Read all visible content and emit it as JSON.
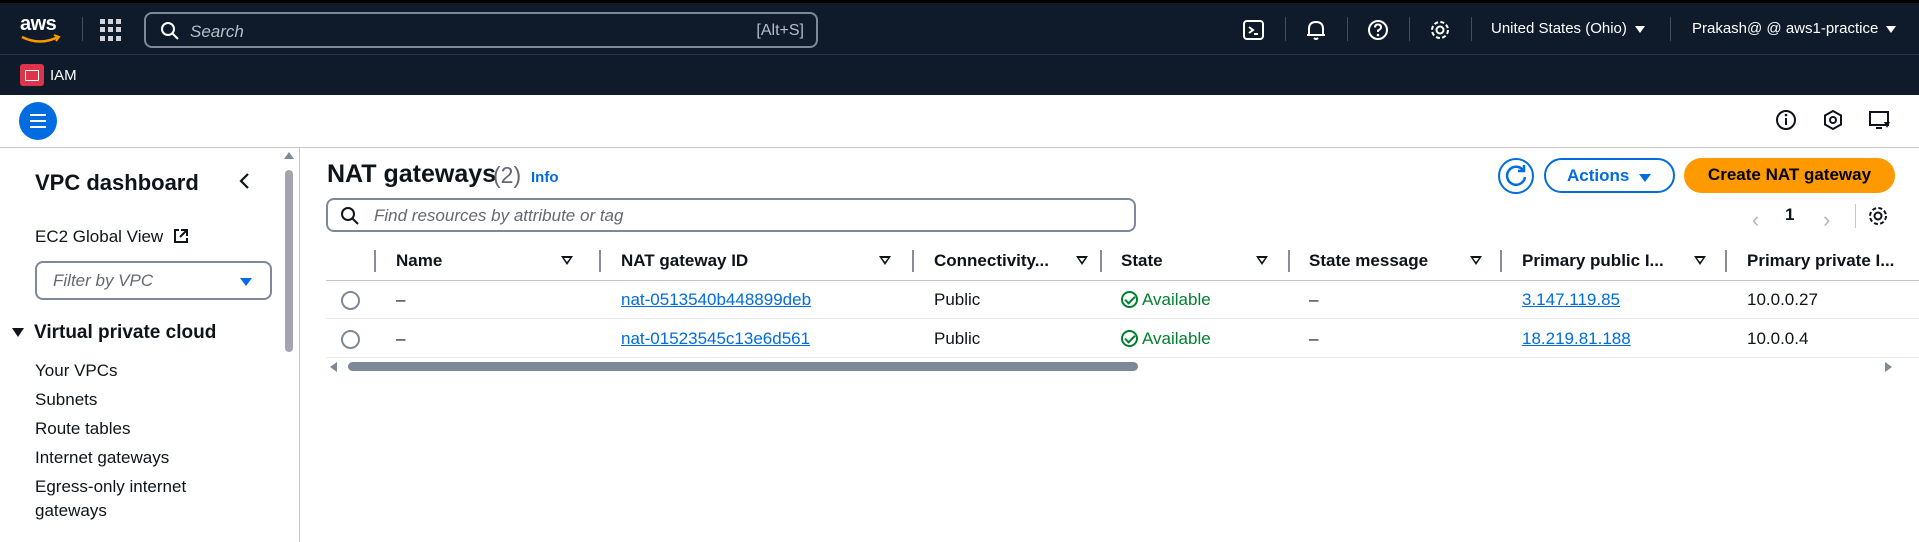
{
  "topnav": {
    "logo": "aws",
    "search_placeholder": "Search",
    "search_shortcut": "[Alt+S]",
    "region": "United States (Ohio)",
    "account": "Prakash@ @ aws1-practice",
    "icons": [
      "cloudshell-icon",
      "bell-icon",
      "help-icon",
      "gear-icon"
    ]
  },
  "service_bar": {
    "label": "IAM",
    "icon": "iam-icon"
  },
  "sidebar": {
    "title": "VPC dashboard",
    "global_view": "EC2 Global View",
    "filter_placeholder": "Filter by VPC",
    "section": "Virtual private cloud",
    "items": [
      "Your VPCs",
      "Subnets",
      "Route tables",
      "Internet gateways",
      "Egress-only internet gateways"
    ]
  },
  "main": {
    "title": "NAT gateways",
    "count": "(2)",
    "info": "Info",
    "actions": "Actions",
    "create": "Create NAT gateway",
    "search_placeholder": "Find resources by attribute or tag",
    "page": "1"
  },
  "table": {
    "columns": [
      "Name",
      "NAT gateway ID",
      "Connectivity...",
      "State",
      "State message",
      "Primary public I...",
      "Primary private I..."
    ],
    "rows": [
      {
        "name": "–",
        "id": "nat-0513540b448899deb",
        "connectivity": "Public",
        "state": "Available",
        "message": "–",
        "public_ip": "3.147.119.85",
        "private_ip": "10.0.0.27"
      },
      {
        "name": "–",
        "id": "nat-01523545c13e6d561",
        "connectivity": "Public",
        "state": "Available",
        "message": "–",
        "public_ip": "18.219.81.188",
        "private_ip": "10.0.0.4"
      }
    ]
  },
  "colors": {
    "nav_bg": "#0f1b2a",
    "link": "#006ce0",
    "primary": "#ff9900",
    "success": "#00802f"
  }
}
